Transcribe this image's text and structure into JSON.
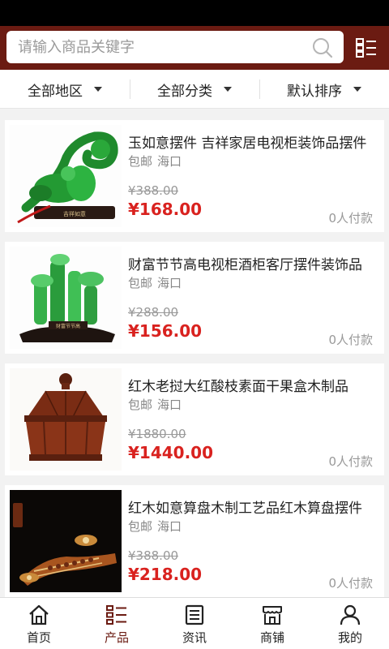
{
  "search": {
    "placeholder": "请输入商品关键字"
  },
  "filters": [
    {
      "label": "全部地区"
    },
    {
      "label": "全部分类"
    },
    {
      "label": "默认排序"
    }
  ],
  "products": [
    {
      "title": "玉如意摆件 吉祥家居电视柜装饰品摆件",
      "shipping": "包邮",
      "location": "海口",
      "old_price": "¥388.00",
      "price": "¥168.00",
      "paid": "0人付款",
      "plaque": "吉祥如意"
    },
    {
      "title": "财富节节高电视柜酒柜客厅摆件装饰品",
      "shipping": "包邮",
      "location": "海口",
      "old_price": "¥288.00",
      "price": "¥156.00",
      "paid": "0人付款",
      "plaque": "财富节节高"
    },
    {
      "title": "红木老挝大红酸枝素面干果盒木制品",
      "shipping": "包邮",
      "location": "海口",
      "old_price": "¥1880.00",
      "price": "¥1440.00",
      "paid": "0人付款"
    },
    {
      "title": "红木如意算盘木制工艺品红木算盘摆件",
      "shipping": "包邮",
      "location": "海口",
      "old_price": "¥388.00",
      "price": "¥218.00",
      "paid": "0人付款"
    }
  ],
  "tabs": [
    {
      "label": "首页",
      "icon": "home-icon"
    },
    {
      "label": "产品",
      "icon": "product-list-icon",
      "active": true
    },
    {
      "label": "资讯",
      "icon": "news-icon"
    },
    {
      "label": "商铺",
      "icon": "store-icon"
    },
    {
      "label": "我的",
      "icon": "user-icon"
    }
  ],
  "colors": {
    "brand": "#6b1b12",
    "price": "#d9221f"
  }
}
